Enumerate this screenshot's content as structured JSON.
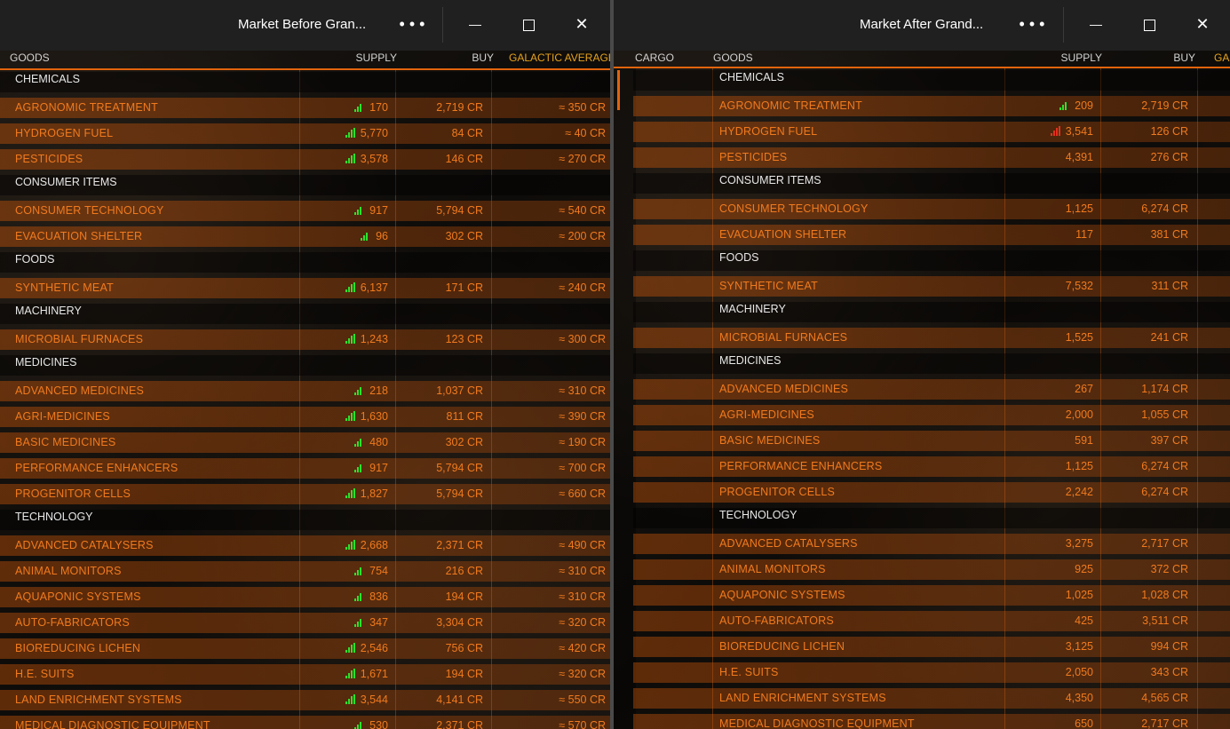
{
  "left": {
    "title": "Market Before Gran...",
    "headers": {
      "goods": "GOODS",
      "supply": "SUPPLY",
      "buy": "BUY",
      "galactic_average": "GALACTIC AVERAGE"
    },
    "rows": [
      {
        "type": "cat",
        "name": "CHEMICALS"
      },
      {
        "type": "item",
        "name": "AGRONOMIC TREATMENT",
        "trend": "green3",
        "supply": "170",
        "buy": "2,719 CR",
        "avg": "≈ 350 CR"
      },
      {
        "type": "item",
        "name": "HYDROGEN FUEL",
        "trend": "green4",
        "supply": "5,770",
        "buy": "84 CR",
        "avg": "≈ 40 CR"
      },
      {
        "type": "item",
        "name": "PESTICIDES",
        "trend": "green4",
        "supply": "3,578",
        "buy": "146 CR",
        "avg": "≈ 270 CR"
      },
      {
        "type": "cat",
        "name": "CONSUMER ITEMS"
      },
      {
        "type": "item",
        "name": "CONSUMER TECHNOLOGY",
        "trend": "green3",
        "supply": "917",
        "buy": "5,794 CR",
        "avg": "≈ 540 CR"
      },
      {
        "type": "item",
        "name": "EVACUATION SHELTER",
        "trend": "green3",
        "supply": "96",
        "buy": "302 CR",
        "avg": "≈ 200 CR"
      },
      {
        "type": "cat",
        "name": "FOODS"
      },
      {
        "type": "item",
        "name": "SYNTHETIC MEAT",
        "trend": "green4",
        "supply": "6,137",
        "buy": "171 CR",
        "avg": "≈ 240 CR"
      },
      {
        "type": "cat",
        "name": "MACHINERY"
      },
      {
        "type": "item",
        "name": "MICROBIAL FURNACES",
        "trend": "green4",
        "supply": "1,243",
        "buy": "123 CR",
        "avg": "≈ 300 CR"
      },
      {
        "type": "cat",
        "name": "MEDICINES"
      },
      {
        "type": "item",
        "name": "ADVANCED MEDICINES",
        "trend": "green3",
        "supply": "218",
        "buy": "1,037 CR",
        "avg": "≈ 310 CR"
      },
      {
        "type": "item",
        "name": "AGRI-MEDICINES",
        "trend": "green4",
        "supply": "1,630",
        "buy": "811 CR",
        "avg": "≈ 390 CR"
      },
      {
        "type": "item",
        "name": "BASIC MEDICINES",
        "trend": "green3",
        "supply": "480",
        "buy": "302 CR",
        "avg": "≈ 190 CR"
      },
      {
        "type": "item",
        "name": "PERFORMANCE ENHANCERS",
        "trend": "green3",
        "supply": "917",
        "buy": "5,794 CR",
        "avg": "≈ 700 CR"
      },
      {
        "type": "item",
        "name": "PROGENITOR CELLS",
        "trend": "green4",
        "supply": "1,827",
        "buy": "5,794 CR",
        "avg": "≈ 660 CR"
      },
      {
        "type": "cat",
        "name": "TECHNOLOGY"
      },
      {
        "type": "item",
        "name": "ADVANCED CATALYSERS",
        "trend": "green4",
        "supply": "2,668",
        "buy": "2,371 CR",
        "avg": "≈ 490 CR"
      },
      {
        "type": "item",
        "name": "ANIMAL MONITORS",
        "trend": "green3",
        "supply": "754",
        "buy": "216 CR",
        "avg": "≈ 310 CR"
      },
      {
        "type": "item",
        "name": "AQUAPONIC SYSTEMS",
        "trend": "green3",
        "supply": "836",
        "buy": "194 CR",
        "avg": "≈ 310 CR"
      },
      {
        "type": "item",
        "name": "AUTO-FABRICATORS",
        "trend": "green3",
        "supply": "347",
        "buy": "3,304 CR",
        "avg": "≈ 320 CR"
      },
      {
        "type": "item",
        "name": "BIOREDUCING LICHEN",
        "trend": "green4",
        "supply": "2,546",
        "buy": "756 CR",
        "avg": "≈ 420 CR"
      },
      {
        "type": "item",
        "name": "H.E. SUITS",
        "trend": "green4",
        "supply": "1,671",
        "buy": "194 CR",
        "avg": "≈ 320 CR"
      },
      {
        "type": "item",
        "name": "LAND ENRICHMENT SYSTEMS",
        "trend": "green4",
        "supply": "3,544",
        "buy": "4,141 CR",
        "avg": "≈ 550 CR"
      },
      {
        "type": "item",
        "name": "MEDICAL DIAGNOSTIC EQUIPMENT",
        "trend": "green3",
        "supply": "530",
        "buy": "2,371 CR",
        "avg": "≈ 570 CR"
      }
    ]
  },
  "right": {
    "title": "Market After Grand...",
    "headers": {
      "cargo": "CARGO",
      "goods": "GOODS",
      "supply": "SUPPLY",
      "buy": "BUY",
      "galactic_average": "GA"
    },
    "rows": [
      {
        "type": "cat",
        "name": "CHEMICALS"
      },
      {
        "type": "item",
        "name": "AGRONOMIC TREATMENT",
        "trend": "green3",
        "supply": "209",
        "buy": "2,719 CR"
      },
      {
        "type": "item",
        "name": "HYDROGEN FUEL",
        "trend": "red4",
        "supply": "3,541",
        "buy": "126 CR"
      },
      {
        "type": "item",
        "name": "PESTICIDES",
        "trend": "",
        "supply": "4,391",
        "buy": "276 CR"
      },
      {
        "type": "cat",
        "name": "CONSUMER ITEMS"
      },
      {
        "type": "item",
        "name": "CONSUMER TECHNOLOGY",
        "trend": "",
        "supply": "1,125",
        "buy": "6,274 CR"
      },
      {
        "type": "item",
        "name": "EVACUATION SHELTER",
        "trend": "",
        "supply": "117",
        "buy": "381 CR"
      },
      {
        "type": "cat",
        "name": "FOODS"
      },
      {
        "type": "item",
        "name": "SYNTHETIC MEAT",
        "trend": "",
        "supply": "7,532",
        "buy": "311 CR"
      },
      {
        "type": "cat",
        "name": "MACHINERY"
      },
      {
        "type": "item",
        "name": "MICROBIAL FURNACES",
        "trend": "",
        "supply": "1,525",
        "buy": "241 CR"
      },
      {
        "type": "cat",
        "name": "MEDICINES"
      },
      {
        "type": "item",
        "name": "ADVANCED MEDICINES",
        "trend": "",
        "supply": "267",
        "buy": "1,174 CR"
      },
      {
        "type": "item",
        "name": "AGRI-MEDICINES",
        "trend": "",
        "supply": "2,000",
        "buy": "1,055 CR"
      },
      {
        "type": "item",
        "name": "BASIC MEDICINES",
        "trend": "",
        "supply": "591",
        "buy": "397 CR"
      },
      {
        "type": "item",
        "name": "PERFORMANCE ENHANCERS",
        "trend": "",
        "supply": "1,125",
        "buy": "6,274 CR"
      },
      {
        "type": "item",
        "name": "PROGENITOR CELLS",
        "trend": "",
        "supply": "2,242",
        "buy": "6,274 CR"
      },
      {
        "type": "cat",
        "name": "TECHNOLOGY"
      },
      {
        "type": "item",
        "name": "ADVANCED CATALYSERS",
        "trend": "",
        "supply": "3,275",
        "buy": "2,717 CR"
      },
      {
        "type": "item",
        "name": "ANIMAL MONITORS",
        "trend": "",
        "supply": "925",
        "buy": "372 CR"
      },
      {
        "type": "item",
        "name": "AQUAPONIC SYSTEMS",
        "trend": "",
        "supply": "1,025",
        "buy": "1,028 CR"
      },
      {
        "type": "item",
        "name": "AUTO-FABRICATORS",
        "trend": "",
        "supply": "425",
        "buy": "3,511 CR"
      },
      {
        "type": "item",
        "name": "BIOREDUCING LICHEN",
        "trend": "",
        "supply": "3,125",
        "buy": "994 CR"
      },
      {
        "type": "item",
        "name": "H.E. SUITS",
        "trend": "",
        "supply": "2,050",
        "buy": "343 CR"
      },
      {
        "type": "item",
        "name": "LAND ENRICHMENT SYSTEMS",
        "trend": "",
        "supply": "4,350",
        "buy": "4,565 CR"
      },
      {
        "type": "item",
        "name": "MEDICAL DIAGNOSTIC EQUIPMENT",
        "trend": "",
        "supply": "650",
        "buy": "2,717 CR"
      }
    ]
  },
  "window_controls": {
    "more": "• • •",
    "minimize": "—",
    "close": "✕"
  },
  "colors": {
    "accent": "#e2640c",
    "text_orange": "#f07a1e",
    "header_gold": "#e6a21c",
    "trend_up": "#2ee02e",
    "trend_down": "#e0321e"
  }
}
